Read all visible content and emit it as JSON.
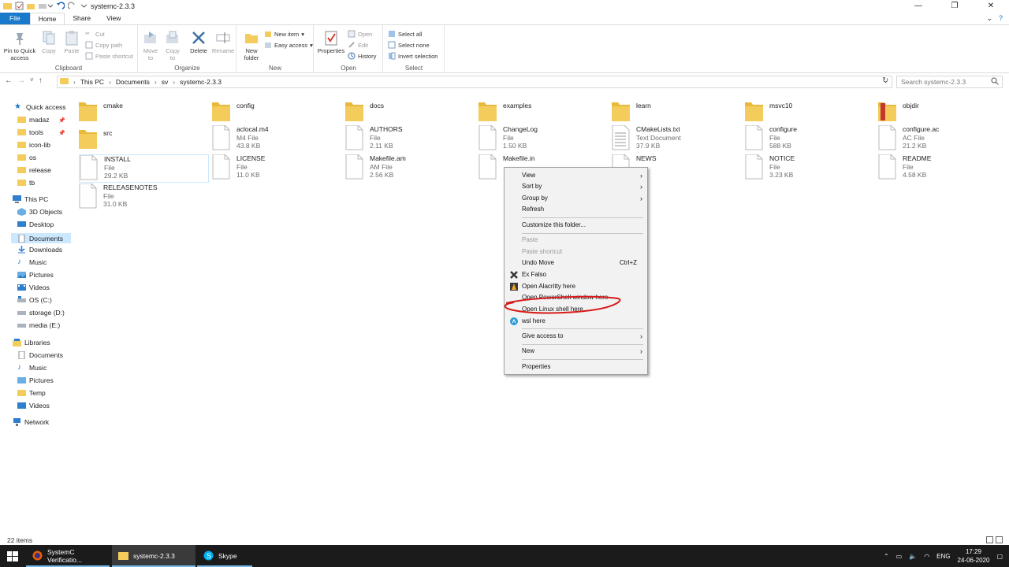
{
  "window": {
    "title": "systemc-2.3.3",
    "controls": [
      "—",
      "❐",
      "✕"
    ]
  },
  "tabs": [
    "File",
    "Home",
    "Share",
    "View"
  ],
  "ribbon": {
    "clipboard": {
      "label": "Clipboard",
      "pin": "Pin to Quick access",
      "copy": "Copy",
      "paste": "Paste",
      "cut": "Cut",
      "copy_path": "Copy path",
      "paste_shortcut": "Paste shortcut"
    },
    "organize": {
      "label": "Organize",
      "move_to": "Move to",
      "copy_to": "Copy to",
      "delete": "Delete",
      "rename": "Rename"
    },
    "new": {
      "label": "New",
      "new_folder": "New folder",
      "new_item": "New item",
      "easy_access": "Easy access"
    },
    "open": {
      "label": "Open",
      "properties": "Properties",
      "open": "Open",
      "edit": "Edit",
      "history": "History"
    },
    "select": {
      "label": "Select",
      "select_all": "Select all",
      "select_none": "Select none",
      "invert": "Invert selection"
    }
  },
  "address": {
    "crumbs": [
      "This PC",
      "Documents",
      "sv",
      "systemc-2.3.3"
    ],
    "search_placeholder": "Search systemc-2.3.3"
  },
  "nav": {
    "quick_access": "Quick access",
    "quick_items": [
      "madaz",
      "tools",
      "icon-lib",
      "os",
      "release",
      "tb"
    ],
    "this_pc": "This PC",
    "pc_items": [
      "3D Objects",
      "Desktop",
      "Documents",
      "Downloads",
      "Music",
      "Pictures",
      "Videos",
      "OS (C:)",
      "storage (D:)",
      "media (E:)"
    ],
    "libraries": "Libraries",
    "lib_items": [
      "Documents",
      "Music",
      "Pictures",
      "Temp",
      "Videos"
    ],
    "network": "Network"
  },
  "files": [
    {
      "name": "cmake",
      "type": "",
      "size": "",
      "kind": "folder"
    },
    {
      "name": "config",
      "type": "",
      "size": "",
      "kind": "folder"
    },
    {
      "name": "docs",
      "type": "",
      "size": "",
      "kind": "folder"
    },
    {
      "name": "examples",
      "type": "",
      "size": "",
      "kind": "folder"
    },
    {
      "name": "learn",
      "type": "",
      "size": "",
      "kind": "folder"
    },
    {
      "name": "msvc10",
      "type": "",
      "size": "",
      "kind": "folder"
    },
    {
      "name": "objdir",
      "type": "",
      "size": "",
      "kind": "folder"
    },
    {
      "name": "src",
      "type": "",
      "size": "",
      "kind": "folder"
    },
    {
      "name": "aclocal.m4",
      "type": "M4 File",
      "size": "43.8 KB",
      "kind": "doc"
    },
    {
      "name": "AUTHORS",
      "type": "File",
      "size": "2.11 KB",
      "kind": "doc"
    },
    {
      "name": "ChangeLog",
      "type": "File",
      "size": "1.50 KB",
      "kind": "doc"
    },
    {
      "name": "CMakeLists.txt",
      "type": "Text Document",
      "size": "37.9 KB",
      "kind": "txt"
    },
    {
      "name": "configure",
      "type": "File",
      "size": "588 KB",
      "kind": "doc"
    },
    {
      "name": "configure.ac",
      "type": "AC File",
      "size": "21.2 KB",
      "kind": "doc"
    },
    {
      "name": "INSTALL",
      "type": "File",
      "size": "29.2 KB",
      "kind": "doc"
    },
    {
      "name": "LICENSE",
      "type": "File",
      "size": "11.0 KB",
      "kind": "doc"
    },
    {
      "name": "Makefile.am",
      "type": "AM File",
      "size": "2.56 KB",
      "kind": "doc"
    },
    {
      "name": "Makefile.in",
      "type": "",
      "size": "",
      "kind": "doc"
    },
    {
      "name": "NEWS",
      "type": "",
      "size": "KB",
      "kind": "doc"
    },
    {
      "name": "NOTICE",
      "type": "File",
      "size": "3.23 KB",
      "kind": "doc"
    },
    {
      "name": "README",
      "type": "File",
      "size": "4.58 KB",
      "kind": "doc"
    },
    {
      "name": "RELEASENOTES",
      "type": "File",
      "size": "31.0 KB",
      "kind": "doc"
    }
  ],
  "context_menu": {
    "view": "View",
    "sort_by": "Sort by",
    "group_by": "Group by",
    "refresh": "Refresh",
    "customize": "Customize this folder...",
    "paste": "Paste",
    "paste_shortcut": "Paste shortcut",
    "undo_move": "Undo Move",
    "undo_shortcut": "Ctrl+Z",
    "ex_falso": "Ex Falso",
    "alacritty": "Open Alacritty here",
    "powershell": "Open PowerShell window here",
    "linux_shell": "Open Linux shell here",
    "wsl": "wsl here",
    "give_access": "Give access to",
    "new": "New",
    "properties": "Properties"
  },
  "status": {
    "items": "22 items"
  },
  "taskbar": {
    "apps": [
      "SystemC Verificatio...",
      "systemc-2.3.3",
      "Skype"
    ],
    "lang": "ENG",
    "time": "17:29",
    "date": "24-06-2020"
  },
  "colors": {
    "accent": "#1979ca",
    "selection": "#cce8ff",
    "folder": "#f3cc5c",
    "annotation": "#d91a1a"
  }
}
